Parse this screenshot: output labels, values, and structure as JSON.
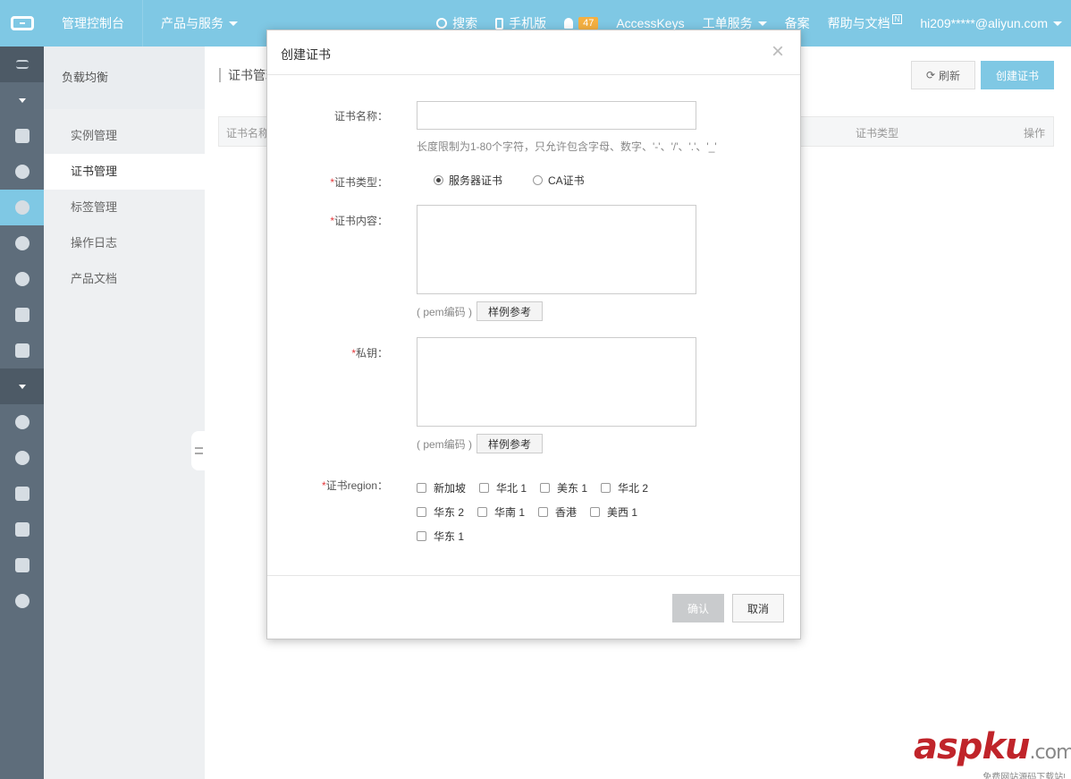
{
  "topbar": {
    "console": "管理控制台",
    "products": "产品与服务",
    "search": "搜索",
    "mobile": "手机版",
    "notifications": "47",
    "accesskeys": "AccessKeys",
    "tickets": "工单服务",
    "beian": "备案",
    "help": "帮助与文档",
    "help_badge": "N",
    "account": "hi209*****@aliyun.com"
  },
  "subbar": {
    "title": "负载均衡",
    "items": [
      "实例管理",
      "证书管理",
      "标签管理",
      "操作日志",
      "产品文档"
    ]
  },
  "main": {
    "title": "证书管理",
    "refresh": "刷新",
    "create": "创建证书",
    "columns": [
      "证书名称",
      "证书类型",
      "操作"
    ]
  },
  "modal": {
    "title": "创建证书",
    "close": "×",
    "name_label": "证书名称：",
    "name_hint": "长度限制为1-80个字符，只允许包含字母、数字、'-'、'/'、'.'、'_'",
    "type_label": "证书类型：",
    "type_options": [
      "服务器证书",
      "CA证书"
    ],
    "content_label": "证书内容：",
    "pem_note": "( pem编码 )",
    "sample_button": "样例参考",
    "key_label": "私钥：",
    "region_label": "证书region：",
    "regions": [
      "新加坡",
      "华北 1",
      "美东 1",
      "华北 2",
      "华东 2",
      "华南 1",
      "香港",
      "美西 1",
      "华东 1"
    ],
    "confirm": "确认",
    "cancel": "取消"
  },
  "watermark": {
    "brand_a": "asp",
    "brand_b": "ku",
    "brand_c": ".com",
    "tagline": "免费网站源码下载站!"
  }
}
